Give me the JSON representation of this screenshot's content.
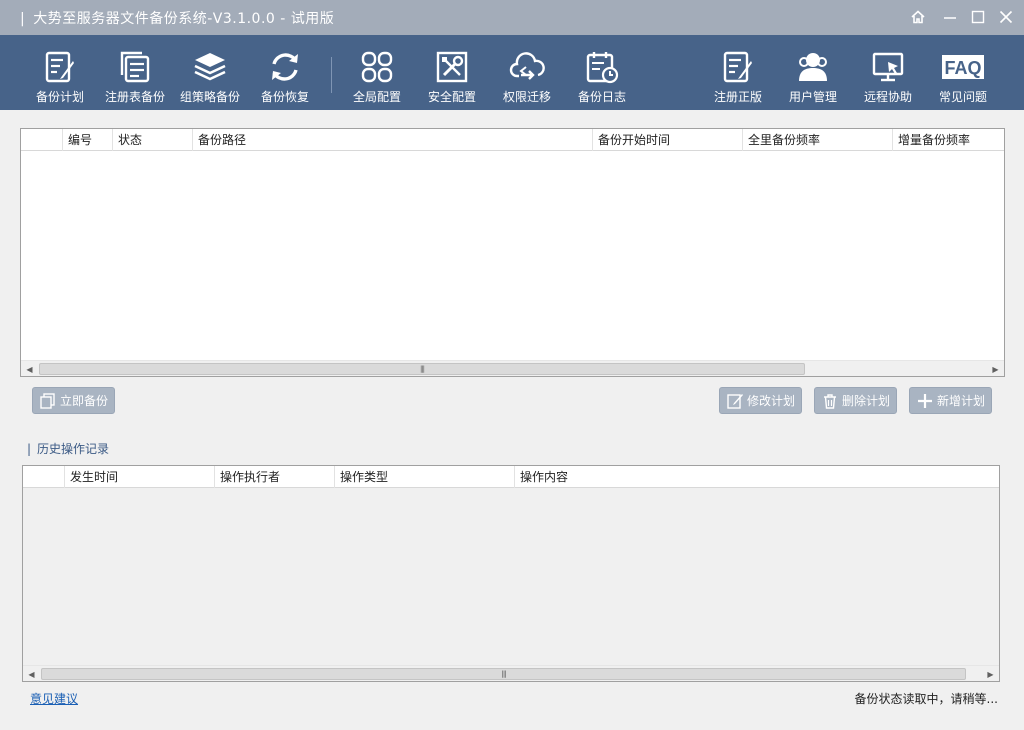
{
  "window": {
    "title": "大势至服务器文件备份系统-V3.1.0.0 - 试用版"
  },
  "toolbar": {
    "items": [
      {
        "label": "备份计划",
        "icon": "backup-plan-icon"
      },
      {
        "label": "注册表备份",
        "icon": "registry-backup-icon"
      },
      {
        "label": "组策略备份",
        "icon": "policy-backup-icon"
      },
      {
        "label": "备份恢复",
        "icon": "restore-icon"
      },
      {
        "label": "全局配置",
        "icon": "global-config-icon"
      },
      {
        "label": "安全配置",
        "icon": "security-config-icon"
      },
      {
        "label": "权限迁移",
        "icon": "permission-migrate-icon"
      },
      {
        "label": "备份日志",
        "icon": "backup-log-icon"
      },
      {
        "label": "注册正版",
        "icon": "register-icon"
      },
      {
        "label": "用户管理",
        "icon": "user-manage-icon"
      },
      {
        "label": "远程协助",
        "icon": "remote-assist-icon"
      },
      {
        "label": "常见问题",
        "icon": "faq-icon",
        "icon_text": "FAQ"
      }
    ]
  },
  "plan_grid": {
    "columns": [
      "",
      "编号",
      "状态",
      "备份路径",
      "备份开始时间",
      "全里备份频率",
      "增量备份频率"
    ],
    "rows": []
  },
  "actions": {
    "backup_now": "立即备份",
    "edit_plan": "修改计划",
    "delete_plan": "删除计划",
    "add_plan": "新增计划"
  },
  "history": {
    "title": "历史操作记录",
    "columns": [
      "",
      "发生时间",
      "操作执行者",
      "操作类型",
      "操作内容"
    ],
    "rows": []
  },
  "footer": {
    "feedback_link": "意见建议",
    "status": "备份状态读取中，请稍等..."
  },
  "colors": {
    "toolbar_bg": "#476389",
    "titlebar_bg": "#a3acb9",
    "button_bg": "#a9b4c2",
    "link": "#1a5fb4"
  }
}
